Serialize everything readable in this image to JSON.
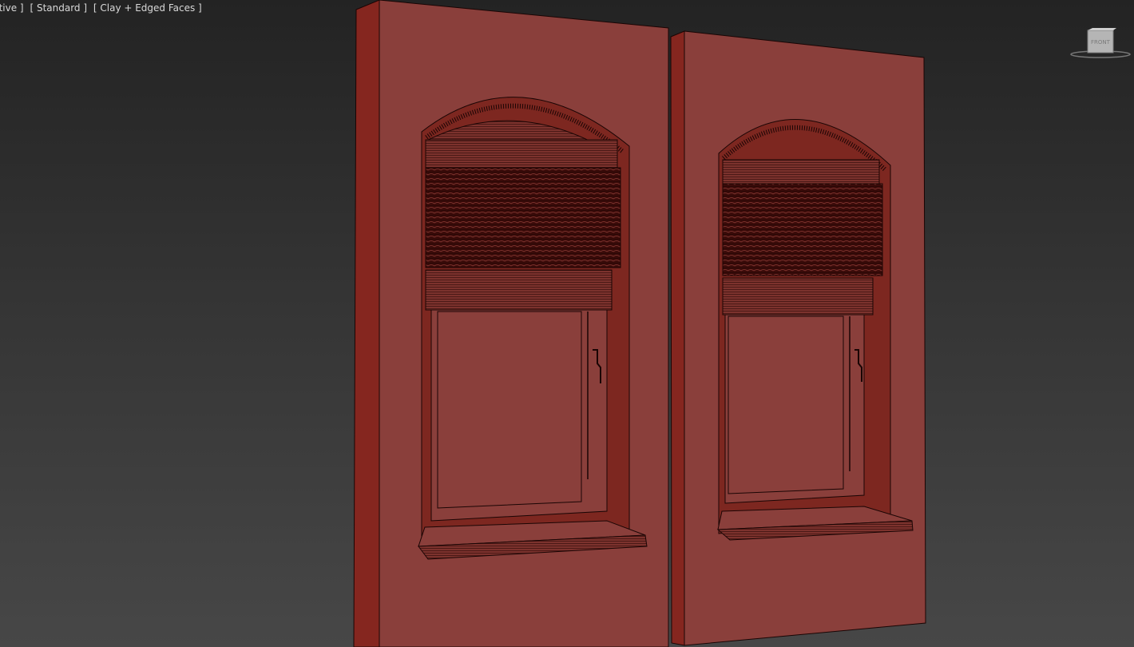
{
  "viewport": {
    "labels": [
      "ctive ]",
      "[ Standard ]",
      "[ Clay + Edged Faces ]"
    ]
  },
  "viewcube": {
    "face_label": "FRONT"
  },
  "scene": {
    "wall_color": "#8a3f3b",
    "wall_side_color": "#85261f",
    "blind_color": "#7a302b",
    "blind_dark_color": "#280606",
    "edge_color": "#1a0504"
  }
}
